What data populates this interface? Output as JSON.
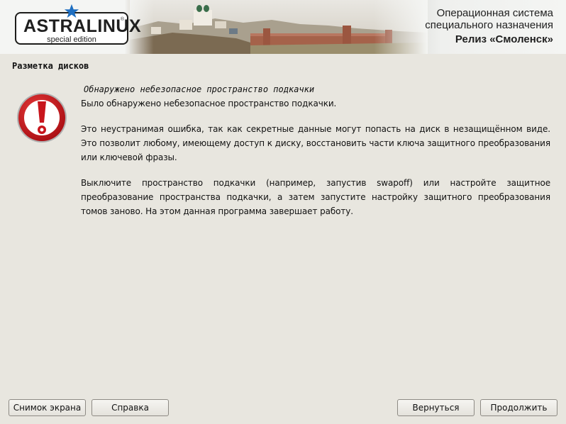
{
  "header": {
    "logo_text": "ASTRALINUX",
    "logo_registered": "®",
    "logo_subtitle": "special edition",
    "os_line1": "Операционная система",
    "os_line2": "специального назначения",
    "release": "Релиз «Смоленск»"
  },
  "page": {
    "title": "Разметка дисков"
  },
  "message": {
    "icon": "warning-exclamation-icon",
    "heading": "Обнаружено небезопасное пространство подкачки",
    "paragraphs": [
      "Было обнаружено небезопасное пространство подкачки.",
      "Это неустранимая ошибка, так как секретные данные могут попасть на диск в незащищённом виде. Это позволит любому, имеющему доступ к диску, восстановить части ключа защитного преобразования или ключевой фразы.",
      "Выключите пространство подкачки (например, запустив swapoff) или настройте защитное преобразование пространства подкачки, а затем запустите настройку защитного преобразования томов заново. На этом данная программа завершает работу."
    ]
  },
  "buttons": {
    "screenshot": "Снимок экрана",
    "help": "Справка",
    "back": "Вернуться",
    "continue": "Продолжить"
  },
  "colors": {
    "background": "#e8e6df",
    "warning_red": "#c8151c",
    "logo_star": "#1f6fc1"
  }
}
